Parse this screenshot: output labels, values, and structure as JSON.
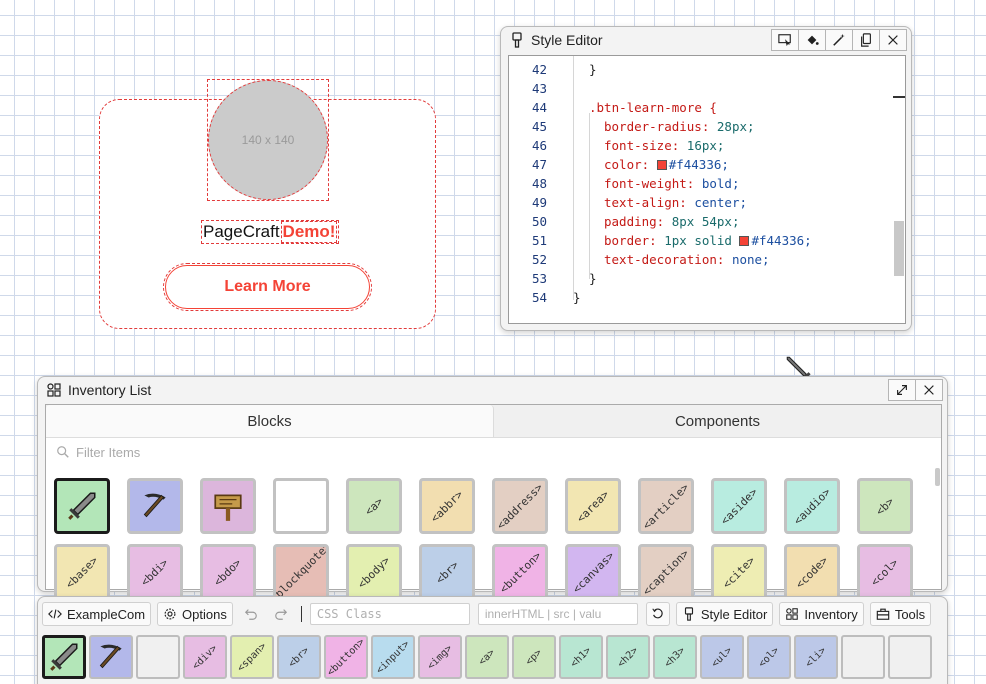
{
  "canvas": {
    "placeholder_text": "140 x 140",
    "headline_prefix": "PageCraft",
    "headline_highlight": "Demo!",
    "button_label": "Learn More",
    "accent_color": "#f44336"
  },
  "style_editor": {
    "title": "Style Editor",
    "lines": [
      {
        "n": "42",
        "text": "}",
        "indent": 1
      },
      {
        "n": "43",
        "text": "",
        "indent": 0
      },
      {
        "n": "44",
        "text": ".btn-learn-more {",
        "indent": 1,
        "kind": "selector"
      },
      {
        "n": "45",
        "prop": "border-radius:",
        "val": "28px;",
        "indent": 2
      },
      {
        "n": "46",
        "prop": "font-size:",
        "val": "16px;",
        "indent": 2
      },
      {
        "n": "47",
        "prop": "color:",
        "val": "#f44336;",
        "indent": 2,
        "swatch": true
      },
      {
        "n": "48",
        "prop": "font-weight:",
        "val": "bold;",
        "indent": 2
      },
      {
        "n": "49",
        "prop": "text-align:",
        "val": "center;",
        "indent": 2
      },
      {
        "n": "50",
        "prop": "padding:",
        "val": "8px 54px;",
        "indent": 2
      },
      {
        "n": "51",
        "prop": "border:",
        "val": "1px solid",
        "val2": "#f44336;",
        "indent": 2,
        "swatch": true
      },
      {
        "n": "52",
        "prop": "text-decoration:",
        "val": "none;",
        "indent": 2
      },
      {
        "n": "53",
        "text": "}",
        "indent": 1
      },
      {
        "n": "54",
        "text": "}",
        "indent": 0
      }
    ]
  },
  "inventory": {
    "title": "Inventory List",
    "tabs": [
      {
        "label": "Blocks",
        "active": true
      },
      {
        "label": "Components",
        "active": false
      }
    ],
    "filter_placeholder": "Filter Items",
    "row1": [
      {
        "kind": "sword-icon",
        "bg": "#b3e6b8",
        "selected": true
      },
      {
        "kind": "pickaxe-icon",
        "bg": "#b3b8ea"
      },
      {
        "kind": "sign-icon",
        "bg": "#dcb6dc"
      },
      {
        "kind": "empty",
        "bg": "#ffffff"
      },
      {
        "label": "<a>",
        "bg": "#cde6bd"
      },
      {
        "label": "<abbr>",
        "bg": "#f2deb0"
      },
      {
        "label": "<address>",
        "bg": "#e3cfc3"
      },
      {
        "label": "<area>",
        "bg": "#f2e6b2"
      },
      {
        "label": "<article>",
        "bg": "#e3cfc3"
      },
      {
        "label": "<aside>",
        "bg": "#b8ece0"
      },
      {
        "label": "<audio>",
        "bg": "#b8ece0"
      },
      {
        "label": "<b>",
        "bg": "#cde6bd"
      }
    ],
    "row2": [
      {
        "label": "<base>",
        "bg": "#f2e6b2"
      },
      {
        "label": "<bdi>",
        "bg": "#e7bde3"
      },
      {
        "label": "<bdo>",
        "bg": "#e7bde3"
      },
      {
        "label": "<blockquote>",
        "bg": "#e6bdb5"
      },
      {
        "label": "<body>",
        "bg": "#e3efb0"
      },
      {
        "label": "<br>",
        "bg": "#bccfe8"
      },
      {
        "label": "<button>",
        "bg": "#f0b3e6"
      },
      {
        "label": "<canvas>",
        "bg": "#d2b6f0"
      },
      {
        "label": "<caption>",
        "bg": "#e3cfc3"
      },
      {
        "label": "<cite>",
        "bg": "#eeedb3"
      },
      {
        "label": "<code>",
        "bg": "#f2deb0"
      },
      {
        "label": "<col>",
        "bg": "#e7bde3"
      }
    ]
  },
  "toolbar": {
    "project_label": "ExampleCom",
    "options_label": "Options",
    "css_class_placeholder": "CSS Class",
    "inner_html_placeholder": "innerHTML | src | valu",
    "style_editor_label": "Style Editor",
    "inventory_label": "Inventory",
    "tools_label": "Tools",
    "hotbar": [
      {
        "kind": "sword-icon",
        "bg": "#b3e6b8",
        "selected": true
      },
      {
        "kind": "pickaxe-icon",
        "bg": "#b3b8ea"
      },
      {
        "kind": "empty",
        "bg": "#f0f0f0"
      },
      {
        "label": "<div>",
        "bg": "#e7bde3"
      },
      {
        "label": "<span>",
        "bg": "#e3efb0"
      },
      {
        "label": "<br>",
        "bg": "#bccfe8"
      },
      {
        "label": "<button>",
        "bg": "#f0b3e6"
      },
      {
        "label": "<input>",
        "bg": "#b8dcee"
      },
      {
        "label": "<img>",
        "bg": "#e7bde3"
      },
      {
        "label": "<a>",
        "bg": "#cde6bd"
      },
      {
        "label": "<p>",
        "bg": "#cde6bd"
      },
      {
        "label": "<h1>",
        "bg": "#b8e6d2"
      },
      {
        "label": "<h2>",
        "bg": "#b8e6d2"
      },
      {
        "label": "<h3>",
        "bg": "#b8e6d2"
      },
      {
        "label": "<ul>",
        "bg": "#bcc8e8"
      },
      {
        "label": "<ol>",
        "bg": "#bcc8e8"
      },
      {
        "label": "<li>",
        "bg": "#bcc8e8"
      },
      {
        "kind": "empty",
        "bg": "#f0f0f0"
      },
      {
        "kind": "empty",
        "bg": "#f0f0f0"
      }
    ]
  }
}
